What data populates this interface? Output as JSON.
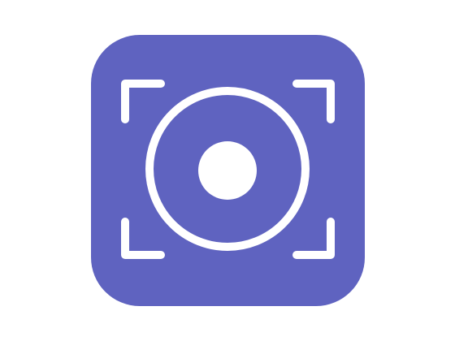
{
  "icon": {
    "name": "screen-recorder-app-icon",
    "glyphs": [
      "viewfinder-corner-icon",
      "record-ring-icon",
      "record-dot-icon"
    ]
  },
  "colors": {
    "background": "#ffffff",
    "tile": "#5f63c0",
    "glyph": "#ffffff"
  }
}
